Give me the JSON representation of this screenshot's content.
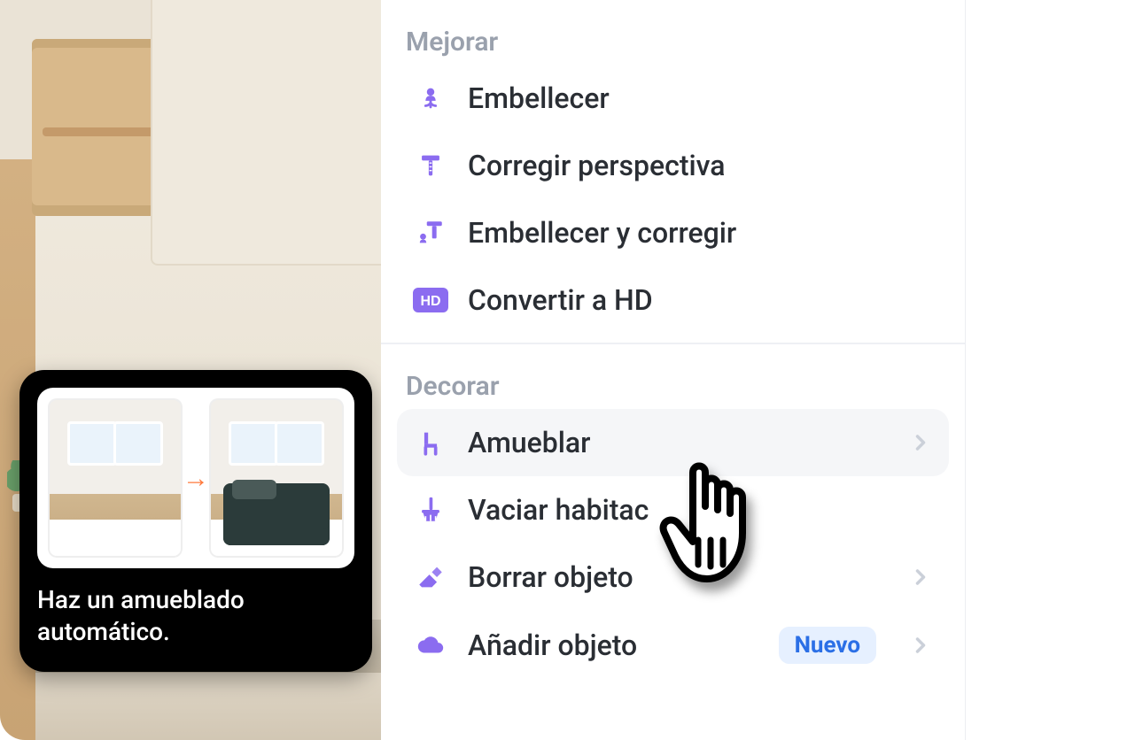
{
  "sections": {
    "improve": {
      "title": "Mejorar",
      "items": [
        {
          "label": "Embellecer"
        },
        {
          "label": "Corregir perspectiva"
        },
        {
          "label": "Embellecer y corregir"
        },
        {
          "label": "Convertir a HD"
        }
      ]
    },
    "decorate": {
      "title": "Decorar",
      "items": [
        {
          "label": "Amueblar"
        },
        {
          "label": "Vaciar habitac"
        },
        {
          "label": "Borrar objeto"
        },
        {
          "label": "Añadir objeto",
          "badge": "Nuevo"
        }
      ]
    }
  },
  "tooltip": {
    "text": "Haz un amueblado automático."
  },
  "colors": {
    "accent": "#8b6cf0",
    "badge_bg": "#e6f0ff",
    "badge_fg": "#2b6fe6"
  }
}
